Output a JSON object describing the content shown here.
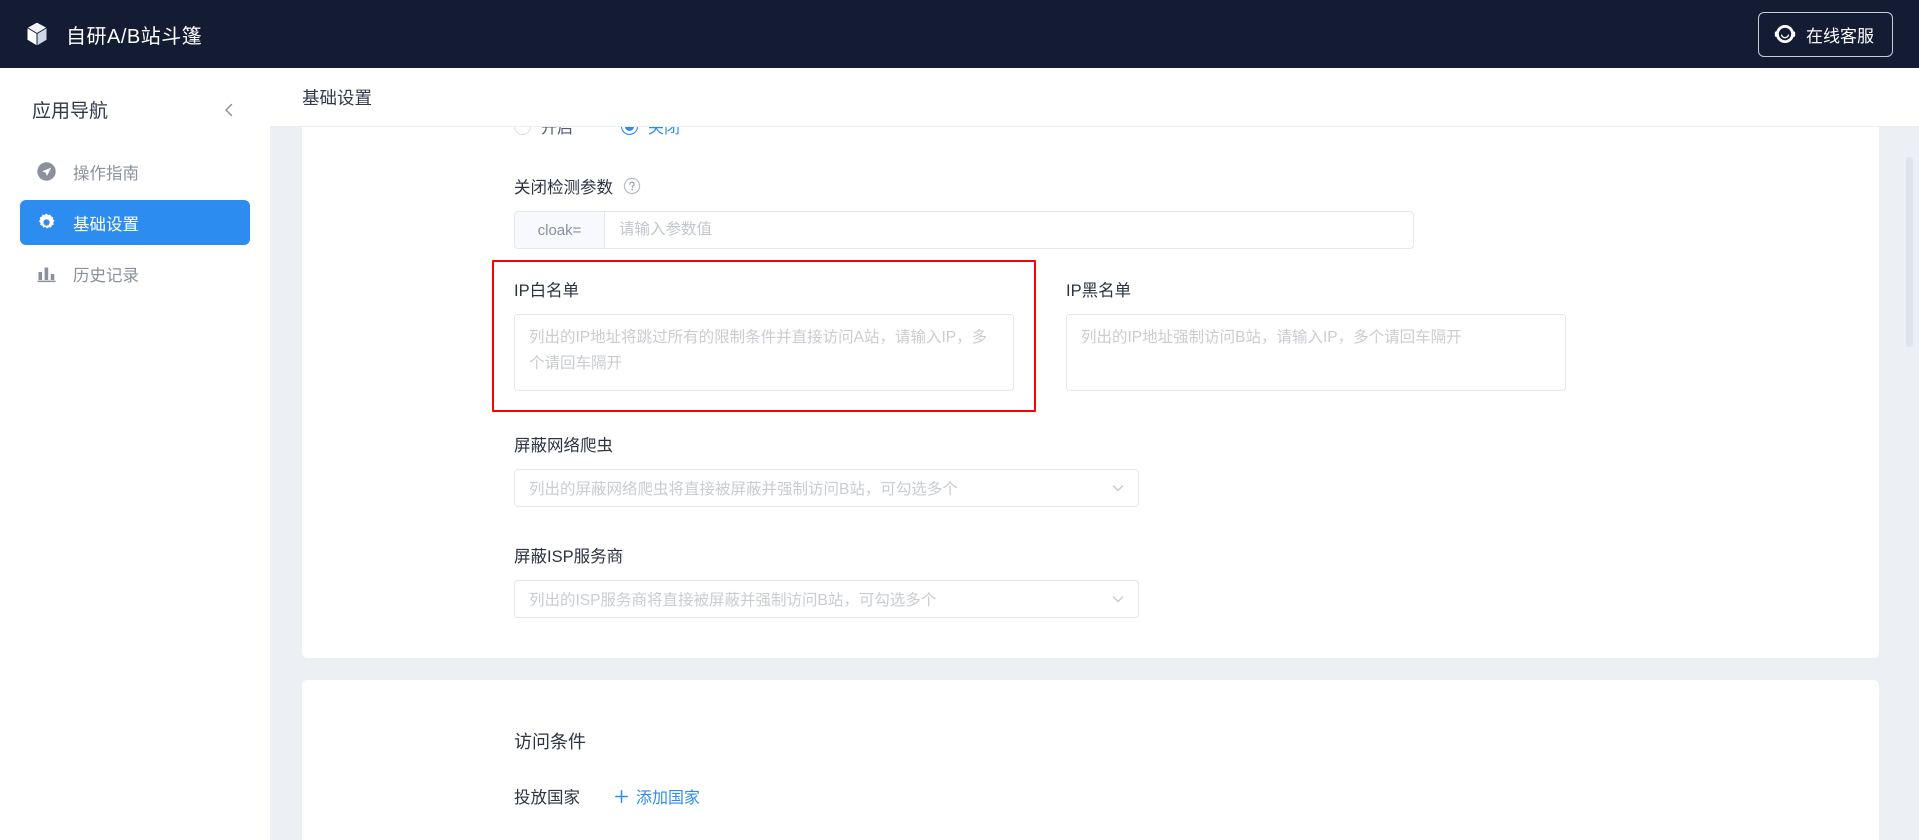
{
  "topbar": {
    "brand_title": "自研A/B站斗篷",
    "brand_icon": "cube-icon",
    "support_button": {
      "label": "在线客服",
      "icon": "headset-icon"
    }
  },
  "sidebar": {
    "title": "应用导航",
    "collapse_icon": "chevron-left-icon",
    "items": [
      {
        "label": "操作指南",
        "icon": "guide-send-icon",
        "active": false
      },
      {
        "label": "基础设置",
        "icon": "gear-icon",
        "active": true
      },
      {
        "label": "历史记录",
        "icon": "bar-chart-icon",
        "active": false
      }
    ]
  },
  "page": {
    "title": "基础设置"
  },
  "settings_card": {
    "toggle_radio": {
      "options": [
        {
          "label": "开启",
          "selected": false
        },
        {
          "label": "关闭",
          "selected": true
        }
      ]
    },
    "detect_param": {
      "label": "关闭检测参数",
      "help_icon": "question-circle-icon",
      "addon_text": "cloak=",
      "value": "",
      "placeholder": "请输入参数值"
    },
    "ip_whitelist": {
      "label": "IP白名单",
      "value": "",
      "placeholder": "列出的IP地址将跳过所有的限制条件并直接访问A站，请输入IP，多个请回车隔开",
      "highlighted": true,
      "highlight_color": "#ff0000"
    },
    "ip_blacklist": {
      "label": "IP黑名单",
      "value": "",
      "placeholder": "列出的IP地址强制访问B站，请输入IP，多个请回车隔开"
    },
    "block_crawlers": {
      "label": "屏蔽网络爬虫",
      "value": "",
      "placeholder": "列出的屏蔽网络爬虫将直接被屏蔽并强制访问B站，可勾选多个",
      "chevron_icon": "chevron-down-icon"
    },
    "block_isp": {
      "label": "屏蔽ISP服务商",
      "value": "",
      "placeholder": "列出的ISP服务商将直接被屏蔽并强制访问B站，可勾选多个",
      "chevron_icon": "chevron-down-icon"
    }
  },
  "access_card": {
    "section_title": "访问条件",
    "country_label": "投放国家",
    "add_country_label": "添加国家",
    "add_icon": "plus-icon"
  },
  "colors": {
    "accent": "#2d8cf0",
    "topbar_bg": "#141c33",
    "page_bg": "#eceff4",
    "highlight": "#ff0000"
  }
}
